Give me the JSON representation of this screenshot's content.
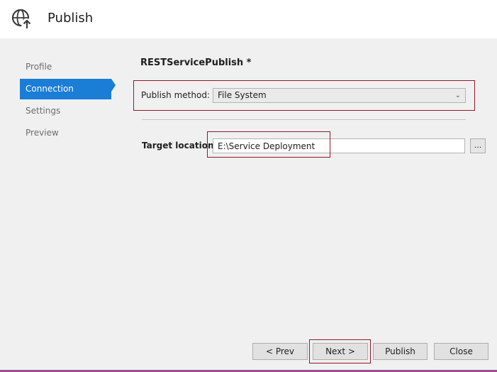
{
  "header": {
    "title": "Publish",
    "icon": "globe-upload-icon"
  },
  "nav": {
    "items": [
      {
        "label": "Profile"
      },
      {
        "label": "Connection"
      },
      {
        "label": "Settings"
      },
      {
        "label": "Preview"
      }
    ],
    "active_index": 1
  },
  "main": {
    "profile_name": "RESTServicePublish *",
    "publish_method": {
      "label": "Publish method:",
      "value": "File System"
    },
    "target_location": {
      "label": "Target location:",
      "value": "E:\\Service Deployment",
      "browse_label": "..."
    }
  },
  "footer": {
    "prev_label": "< Prev",
    "next_label": "Next >",
    "publish_label": "Publish",
    "close_label": "Close"
  },
  "colors": {
    "accent": "#1a7ed7",
    "highlight_border": "#8a1b2a",
    "bottom_bar": "#9b4f96"
  }
}
